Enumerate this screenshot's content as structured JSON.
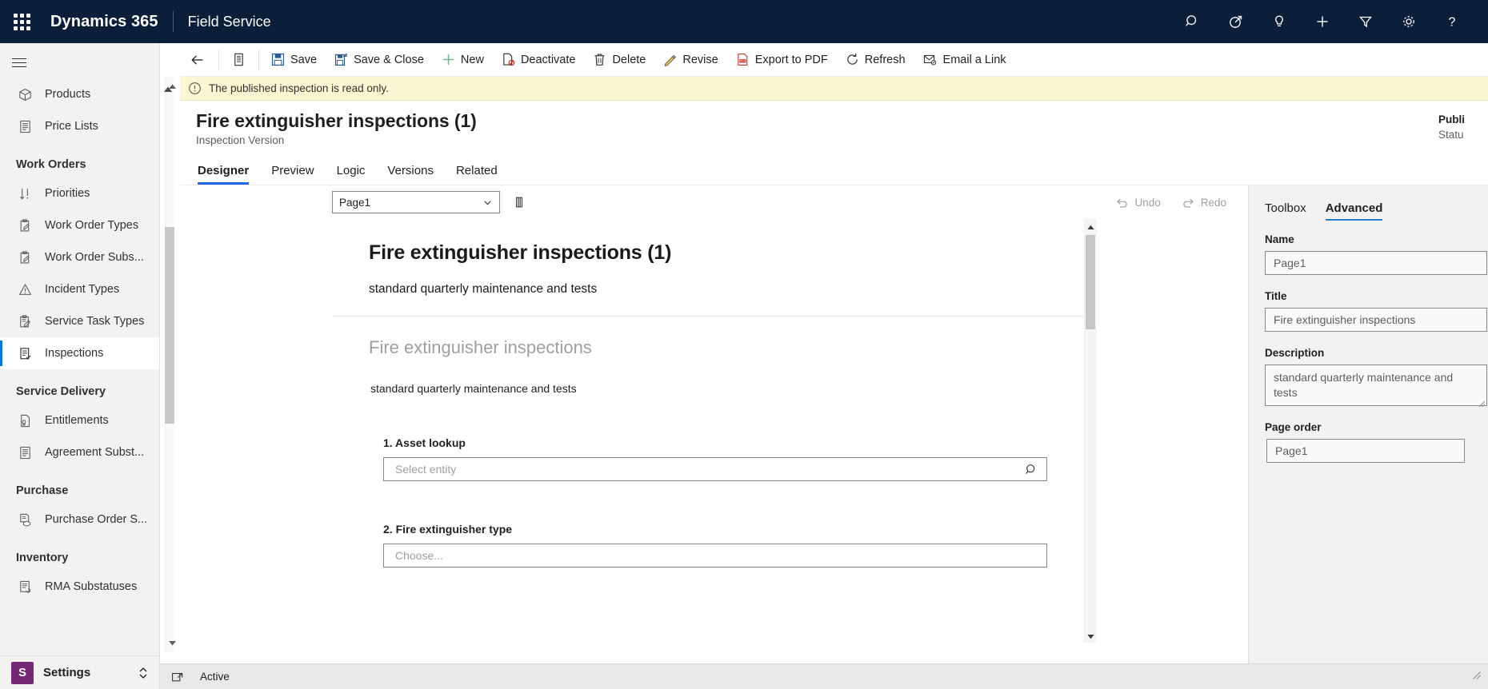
{
  "topbar": {
    "waffle_label": "app-launcher",
    "brand": "Dynamics 365",
    "app_name": "Field Service",
    "icons": [
      {
        "name": "search-icon",
        "label": "Search"
      },
      {
        "name": "assistant-icon",
        "label": "Relationship assistant"
      },
      {
        "name": "lightbulb-icon",
        "label": "Insights"
      },
      {
        "name": "plus-icon",
        "label": "Quick create"
      },
      {
        "name": "filter-icon",
        "label": "Filter"
      },
      {
        "name": "gear-icon",
        "label": "Settings"
      },
      {
        "name": "help-icon",
        "label": "Help"
      }
    ]
  },
  "sidebar": {
    "items": [
      {
        "label": "Products",
        "icon": "product-box-icon",
        "type": "item",
        "selected": false
      },
      {
        "label": "Price Lists",
        "icon": "price-list-icon",
        "type": "item",
        "selected": false
      },
      {
        "label": "Work Orders",
        "type": "group"
      },
      {
        "label": "Priorities",
        "icon": "sort-priority-icon",
        "type": "item",
        "selected": false
      },
      {
        "label": "Work Order Types",
        "icon": "clipboard-pen-icon",
        "type": "item",
        "selected": false
      },
      {
        "label": "Work Order Subs...",
        "icon": "clipboard-pen-icon",
        "type": "item",
        "selected": false
      },
      {
        "label": "Incident Types",
        "icon": "warning-triangle-icon",
        "type": "item",
        "selected": false
      },
      {
        "label": "Service Task Types",
        "icon": "clipboard-task-icon",
        "type": "item",
        "selected": false
      },
      {
        "label": "Inspections",
        "icon": "clipboard-check-icon",
        "type": "item",
        "selected": true
      },
      {
        "label": "Service Delivery",
        "type": "group"
      },
      {
        "label": "Entitlements",
        "icon": "entitlement-icon",
        "type": "item",
        "selected": false
      },
      {
        "label": "Agreement Subst...",
        "icon": "document-lines-icon",
        "type": "item",
        "selected": false
      },
      {
        "label": "Purchase",
        "type": "group"
      },
      {
        "label": "Purchase Order S...",
        "icon": "purchase-order-icon",
        "type": "item",
        "selected": false
      },
      {
        "label": "Inventory",
        "type": "group"
      },
      {
        "label": "RMA Substatuses",
        "icon": "rma-icon",
        "type": "item",
        "selected": false
      }
    ],
    "footer": {
      "tile": "S",
      "label": "Settings"
    }
  },
  "commandbar": {
    "back_label": "Back",
    "form_selector_label": "Form selector",
    "buttons": [
      {
        "label": "Save",
        "icon": "save-icon"
      },
      {
        "label": "Save & Close",
        "icon": "save-close-icon"
      },
      {
        "label": "New",
        "icon": "plus-icon"
      },
      {
        "label": "Deactivate",
        "icon": "deactivate-icon"
      },
      {
        "label": "Delete",
        "icon": "trash-icon"
      },
      {
        "label": "Revise",
        "icon": "pencil-icon"
      },
      {
        "label": "Export to PDF",
        "icon": "pdf-icon"
      },
      {
        "label": "Refresh",
        "icon": "refresh-icon"
      },
      {
        "label": "Email a Link",
        "icon": "email-link-icon"
      }
    ]
  },
  "notification": {
    "icon": "info-circle-icon",
    "message": "The published inspection is read only."
  },
  "record": {
    "title": "Fire extinguisher inspections (1)",
    "subtitle": "Inspection Version",
    "status_value": "Publi",
    "status_label": "Statu"
  },
  "tabs": [
    {
      "label": "Designer",
      "active": true
    },
    {
      "label": "Preview",
      "active": false
    },
    {
      "label": "Logic",
      "active": false
    },
    {
      "label": "Versions",
      "active": false
    },
    {
      "label": "Related",
      "active": false
    }
  ],
  "designer": {
    "page_selector_value": "Page1",
    "page_settings_icon": "page-settings-icon",
    "undo_label": "Undo",
    "redo_label": "Redo",
    "card": {
      "heading": "Fire extinguisher inspections (1)",
      "subheading": "standard quarterly maintenance and tests",
      "form_title": "Fire extinguisher inspections",
      "form_description": "standard quarterly maintenance and tests",
      "fields": [
        {
          "label": "1. Asset lookup",
          "placeholder": "Select entity",
          "control": "lookup",
          "trail_icon": "search-icon"
        },
        {
          "label": "2. Fire extinguisher type",
          "placeholder": "Choose...",
          "control": "dropdown",
          "trail_icon": ""
        }
      ]
    }
  },
  "properties": {
    "tabs": [
      {
        "label": "Toolbox",
        "active": false
      },
      {
        "label": "Advanced",
        "active": true
      }
    ],
    "fields": [
      {
        "label": "Name",
        "value": "Page1",
        "type": "text"
      },
      {
        "label": "Title",
        "value": "Fire extinguisher inspections",
        "type": "text"
      },
      {
        "label": "Description",
        "value": "standard quarterly maintenance and tests",
        "type": "textarea"
      },
      {
        "label": "Page order",
        "value": "Page1",
        "type": "text-indent"
      }
    ]
  },
  "statusbar": {
    "icon": "popout-icon",
    "text": "Active",
    "right_icon": "resize-icon"
  },
  "colors": {
    "nav_bg": "#0b1f3a",
    "accent": "#0078d4",
    "tab_accent": "#2266e3",
    "panel_accent": "#2b7cd3",
    "notice_bg": "#fdf6d3",
    "sidebar_bg": "#f3f2f1",
    "settings_tile": "#742774"
  }
}
